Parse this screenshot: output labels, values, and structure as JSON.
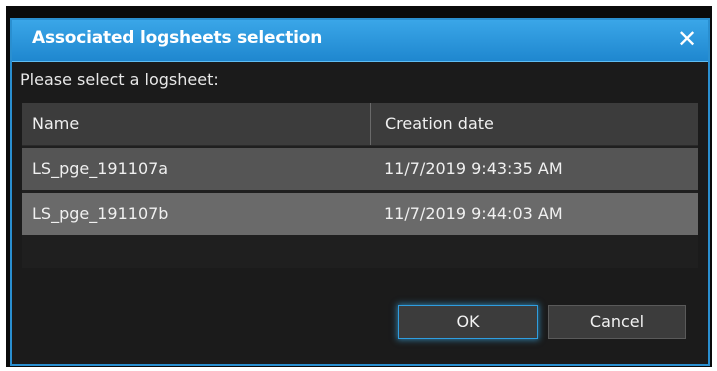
{
  "dialog": {
    "title": "Associated logsheets selection",
    "close_glyph": "✕",
    "prompt": "Please select a logsheet:",
    "accent_color": "#2a8fd0"
  },
  "table": {
    "columns": [
      "Name",
      "Creation date"
    ],
    "rows": [
      [
        "LS_pge_191107a",
        "11/7/2019 9:43:35 AM"
      ],
      [
        "LS_pge_191107b",
        "11/7/2019 9:44:03 AM"
      ]
    ]
  },
  "buttons": {
    "ok_label": "OK",
    "cancel_label": "Cancel"
  },
  "icons": {
    "close": "close-icon"
  }
}
